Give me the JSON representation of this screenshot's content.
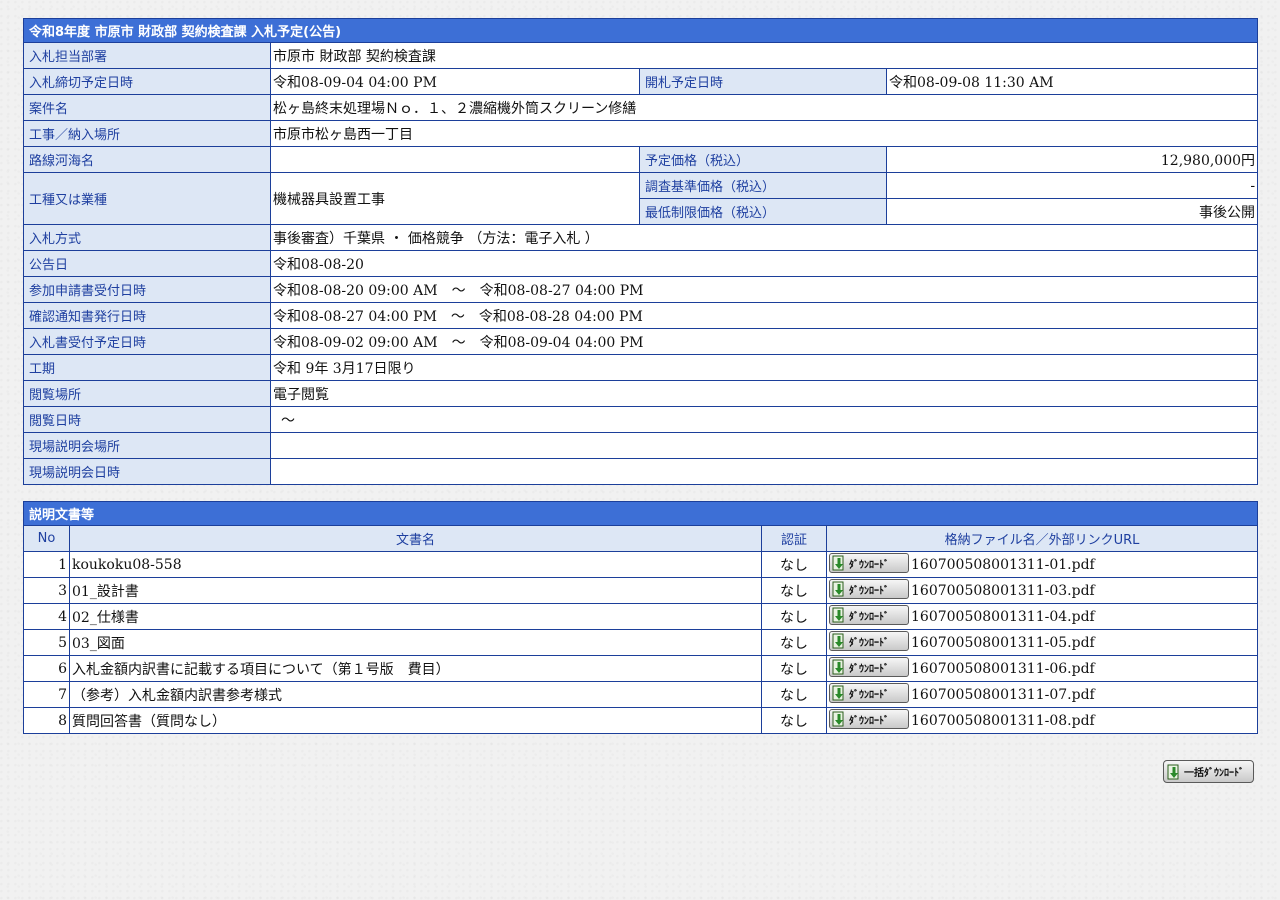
{
  "main_table": {
    "title": "令和8年度 市原市 財政部 契約検査課 入札予定(公告)",
    "department": {
      "label": "入札担当部署",
      "value": "市原市 財政部 契約検査課"
    },
    "deadline": {
      "label": "入札締切予定日時",
      "value": "令和08-09-04 04:00 PM"
    },
    "opening": {
      "label": "開札予定日時",
      "value": "令和08-09-08 11:30 AM"
    },
    "project_name": {
      "label": "案件名",
      "value": "松ヶ島終末処理場Ｎｏ．１、２濃縮機外筒スクリーン修繕"
    },
    "location": {
      "label": "工事／納入場所",
      "value": "市原市松ヶ島西一丁目"
    },
    "route": {
      "label": "路線河海名",
      "value": ""
    },
    "planned_price": {
      "label": "予定価格（税込）",
      "value": "12,980,000円"
    },
    "work_type": {
      "label": "工種又は業種",
      "value": "機械器具設置工事"
    },
    "survey_price": {
      "label": "調査基準価格（税込）",
      "value": "-"
    },
    "min_price": {
      "label": "最低制限価格（税込）",
      "value": "事後公開"
    },
    "method": {
      "label": "入札方式",
      "value": "事後審査）千葉県 ・ 価格競争 （方法：電子入札 ）"
    },
    "notice_date": {
      "label": "公告日",
      "value": "令和08-08-20"
    },
    "application": {
      "label": "参加申請書受付日時",
      "value": "令和08-08-20 09:00 AM　～　令和08-08-27 04:00 PM"
    },
    "confirmation": {
      "label": "確認通知書発行日時",
      "value": "令和08-08-27 04:00 PM　～　令和08-08-28 04:00 PM"
    },
    "bid_receipt": {
      "label": "入札書受付予定日時",
      "value": "令和08-09-02 09:00 AM　～　令和08-09-04 04:00 PM"
    },
    "period": {
      "label": "工期",
      "value": "令和 9年 3月17日限り"
    },
    "viewing_place": {
      "label": "閲覧場所",
      "value": "電子閲覧"
    },
    "viewing_time": {
      "label": "閲覧日時",
      "value": "～"
    },
    "briefing_place": {
      "label": "現場説明会場所",
      "value": ""
    },
    "briefing_time": {
      "label": "現場説明会日時",
      "value": ""
    }
  },
  "docs_table": {
    "title": "説明文書等",
    "headers": {
      "no": "No",
      "name": "文書名",
      "cert": "認証",
      "file": "格納ファイル名／外部リンクURL"
    },
    "download_label": "ﾀﾞｳﾝﾛｰﾄﾞ",
    "rows": [
      {
        "no": "1",
        "name": "koukoku08-558",
        "cert": "なし",
        "file": "160700508001311-01.pdf"
      },
      {
        "no": "3",
        "name": "01_設計書",
        "cert": "なし",
        "file": "160700508001311-03.pdf"
      },
      {
        "no": "4",
        "name": "02_仕様書",
        "cert": "なし",
        "file": "160700508001311-04.pdf"
      },
      {
        "no": "5",
        "name": "03_図面",
        "cert": "なし",
        "file": "160700508001311-05.pdf"
      },
      {
        "no": "6",
        "name": "入札金額内訳書に記載する項目について（第１号版　費目）",
        "cert": "なし",
        "file": "160700508001311-06.pdf"
      },
      {
        "no": "7",
        "name": "（参考）入札金額内訳書参考様式",
        "cert": "なし",
        "file": "160700508001311-07.pdf"
      },
      {
        "no": "8",
        "name": "質問回答書（質問なし）",
        "cert": "なし",
        "file": "160700508001311-08.pdf"
      }
    ]
  },
  "bulk_download_label": "一括ﾀﾞｳﾝﾛｰﾄﾞ",
  "colors": {
    "header_bg": "#3d6fd6",
    "label_bg": "#dde7f5",
    "label_text": "#1e3fa0",
    "border": "#1c3f9a"
  }
}
